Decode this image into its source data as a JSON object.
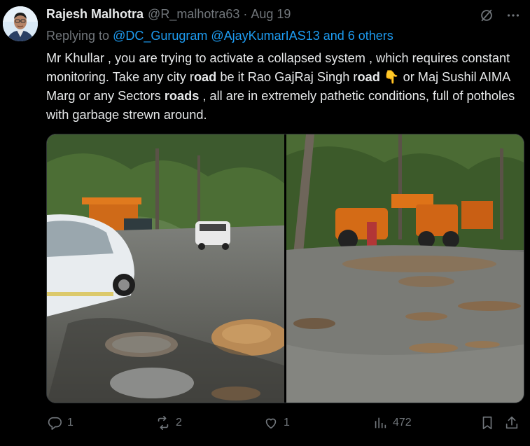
{
  "author": {
    "name": "Rajesh Malhotra",
    "handle": "@R_malhotra63",
    "separator": "·",
    "date": "Aug 19"
  },
  "reply": {
    "prefix": "Replying to ",
    "mentions": "@DC_Gurugram @AjayKumarIAS13 and 6 others"
  },
  "body": {
    "t1": "Mr Khullar , you are trying to activate a collapsed system , which requires constant monitoring. Take any city r",
    "b1": "oad",
    "t2": " be it Rao GajRaj Singh r",
    "b2": "oad",
    "t3": " ",
    "emoji": "👇",
    "t4": " or Maj Sushil AIMA Marg or any Sectors ",
    "b3": "roads",
    "t5": " , all are in extremely pathetic conditions, full of potholes with garbage strewn around."
  },
  "media": {
    "photos": [
      {
        "icon": "road-pothole-photo"
      },
      {
        "icon": "road-construction-photo"
      }
    ]
  },
  "actions": {
    "replies": "1",
    "reposts": "2",
    "likes": "1",
    "views": "472"
  },
  "icons": {
    "grok": "grok-icon",
    "more": "more-icon",
    "reply": "reply-icon",
    "repost": "repost-icon",
    "like": "like-icon",
    "views": "views-icon",
    "bookmark": "bookmark-icon",
    "share": "share-icon"
  },
  "colors": {
    "background": "#000000",
    "text": "#e7e9ea",
    "secondary": "#71767b",
    "link": "#1d9bf0"
  }
}
